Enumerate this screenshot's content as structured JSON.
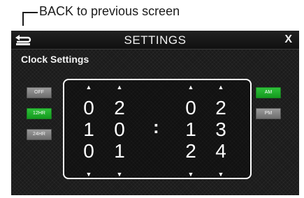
{
  "callout": {
    "text": "BACK to previous screen"
  },
  "header": {
    "title": "SETTINGS",
    "close_label": "X"
  },
  "subtitle": "Clock Settings",
  "format_buttons": [
    {
      "label": "OFF",
      "active": false
    },
    {
      "label": "12HR",
      "active": true
    },
    {
      "label": "24HR",
      "active": false
    }
  ],
  "ampm_buttons": [
    {
      "label": "AM",
      "active": true
    },
    {
      "label": "PM",
      "active": false
    }
  ],
  "clock": {
    "colon": ":",
    "columns": [
      {
        "digits": [
          "0",
          "1",
          "0"
        ]
      },
      {
        "digits": [
          "2",
          "0",
          "1"
        ]
      },
      {
        "digits": [
          "0",
          "1",
          "2"
        ]
      },
      {
        "digits": [
          "2",
          "3",
          "4"
        ]
      }
    ],
    "arrow_up": "▲",
    "arrow_down": "▼"
  },
  "colors": {
    "active": "#1fb02b",
    "inactive": "#8a8a8a",
    "background": "#1b1b1b"
  }
}
